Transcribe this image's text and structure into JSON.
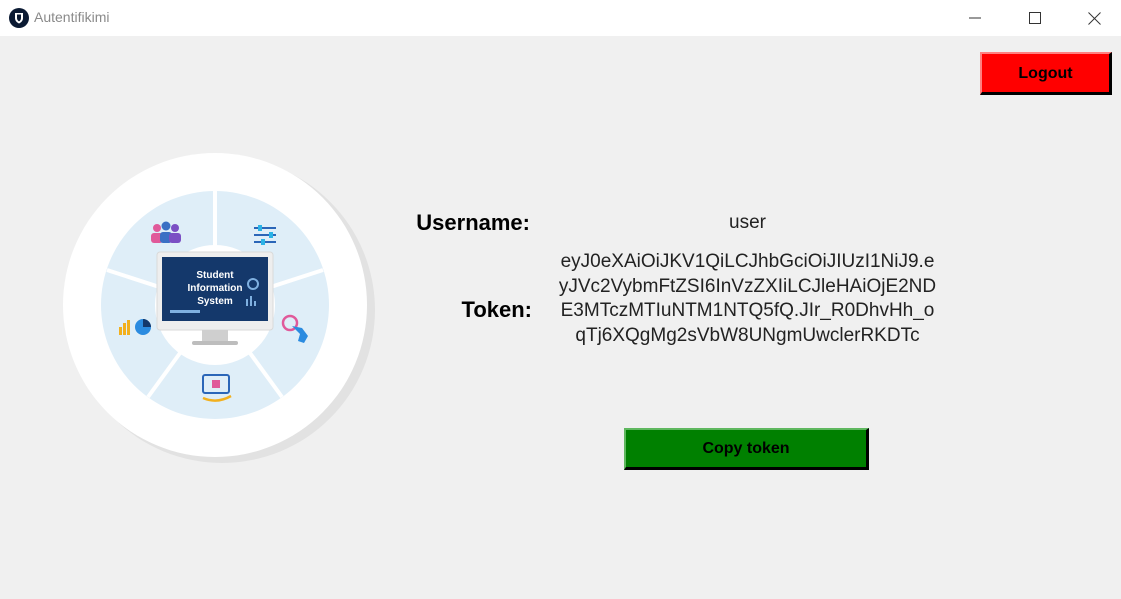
{
  "window": {
    "title": "Autentifikimi",
    "app_icon": "shield-icon"
  },
  "header": {
    "logout_label": "Logout",
    "logout_color": "#ff0000"
  },
  "illustration": {
    "screen_text": [
      "Student",
      "Information",
      "System"
    ]
  },
  "profile": {
    "username_label": "Username:",
    "username_value": "user",
    "token_label": "Token:",
    "token_value": "eyJ0eXAiOiJKV1QiLCJhbGciOiJIUzI1NiJ9.eyJVc2VybmFtZSI6InVzZXIiLCJleHAiOjE2NDE3MTczMTIuNTM1NTQ5fQ.JIr_R0DhvHh_oqTj6XQgMg2sVbW8UNgmUwclerRKDTc",
    "copy_label": "Copy token",
    "copy_color": "#008000"
  }
}
